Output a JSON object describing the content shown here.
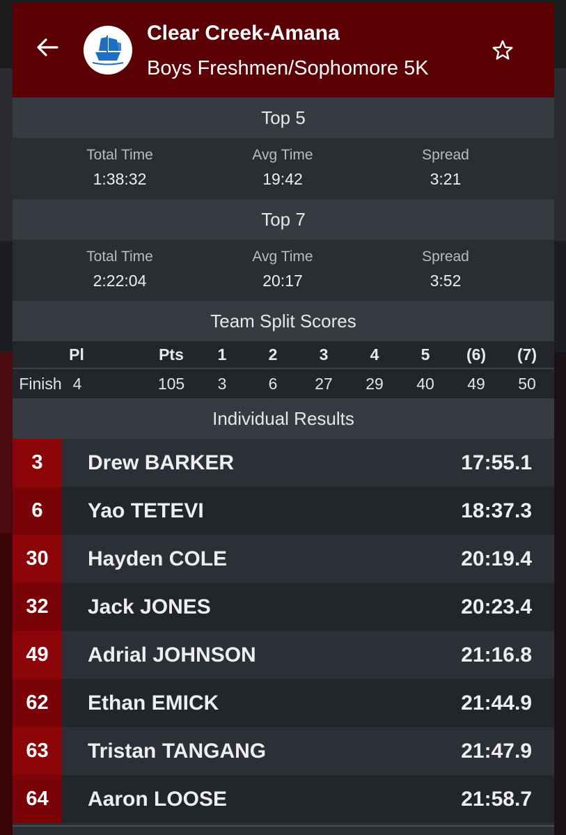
{
  "header": {
    "title": "Clear Creek-Amana",
    "subtitle": "Boys Freshmen/Sophomore 5K"
  },
  "top5": {
    "heading": "Top 5",
    "total_label": "Total Time",
    "total_value": "1:38:32",
    "avg_label": "Avg Time",
    "avg_value": "19:42",
    "spread_label": "Spread",
    "spread_value": "3:21"
  },
  "top7": {
    "heading": "Top 7",
    "total_label": "Total Time",
    "total_value": "2:22:04",
    "avg_label": "Avg Time",
    "avg_value": "20:17",
    "spread_label": "Spread",
    "spread_value": "3:52"
  },
  "split": {
    "heading": "Team Split Scores",
    "columns": [
      "Pl",
      "Pts",
      "1",
      "2",
      "3",
      "4",
      "5",
      "(6)",
      "(7)"
    ],
    "row": {
      "label": "Finish",
      "values": [
        "4",
        "105",
        "3",
        "6",
        "27",
        "29",
        "40",
        "49",
        "50"
      ]
    }
  },
  "individual": {
    "heading": "Individual Results",
    "results": [
      {
        "place": "3",
        "name": "Drew BARKER",
        "time": "17:55.1"
      },
      {
        "place": "6",
        "name": "Yao TETEVI",
        "time": "18:37.3"
      },
      {
        "place": "30",
        "name": "Hayden COLE",
        "time": "20:19.4"
      },
      {
        "place": "32",
        "name": "Jack JONES",
        "time": "20:23.4"
      },
      {
        "place": "49",
        "name": "Adrial JOHNSON",
        "time": "21:16.8"
      },
      {
        "place": "62",
        "name": "Ethan EMICK",
        "time": "21:44.9"
      },
      {
        "place": "63",
        "name": "Tristan TANGANG",
        "time": "21:47.9"
      },
      {
        "place": "64",
        "name": "Aaron LOOSE",
        "time": "21:58.7"
      }
    ]
  },
  "icons": {
    "back": "arrow-left-icon",
    "favorite": "star-outline-icon",
    "logo": "clipper-ship-logo"
  },
  "colors": {
    "header_bg": "#5a0004",
    "place_bg": "#8b0509",
    "logo_blue": "#1f6fc0"
  }
}
